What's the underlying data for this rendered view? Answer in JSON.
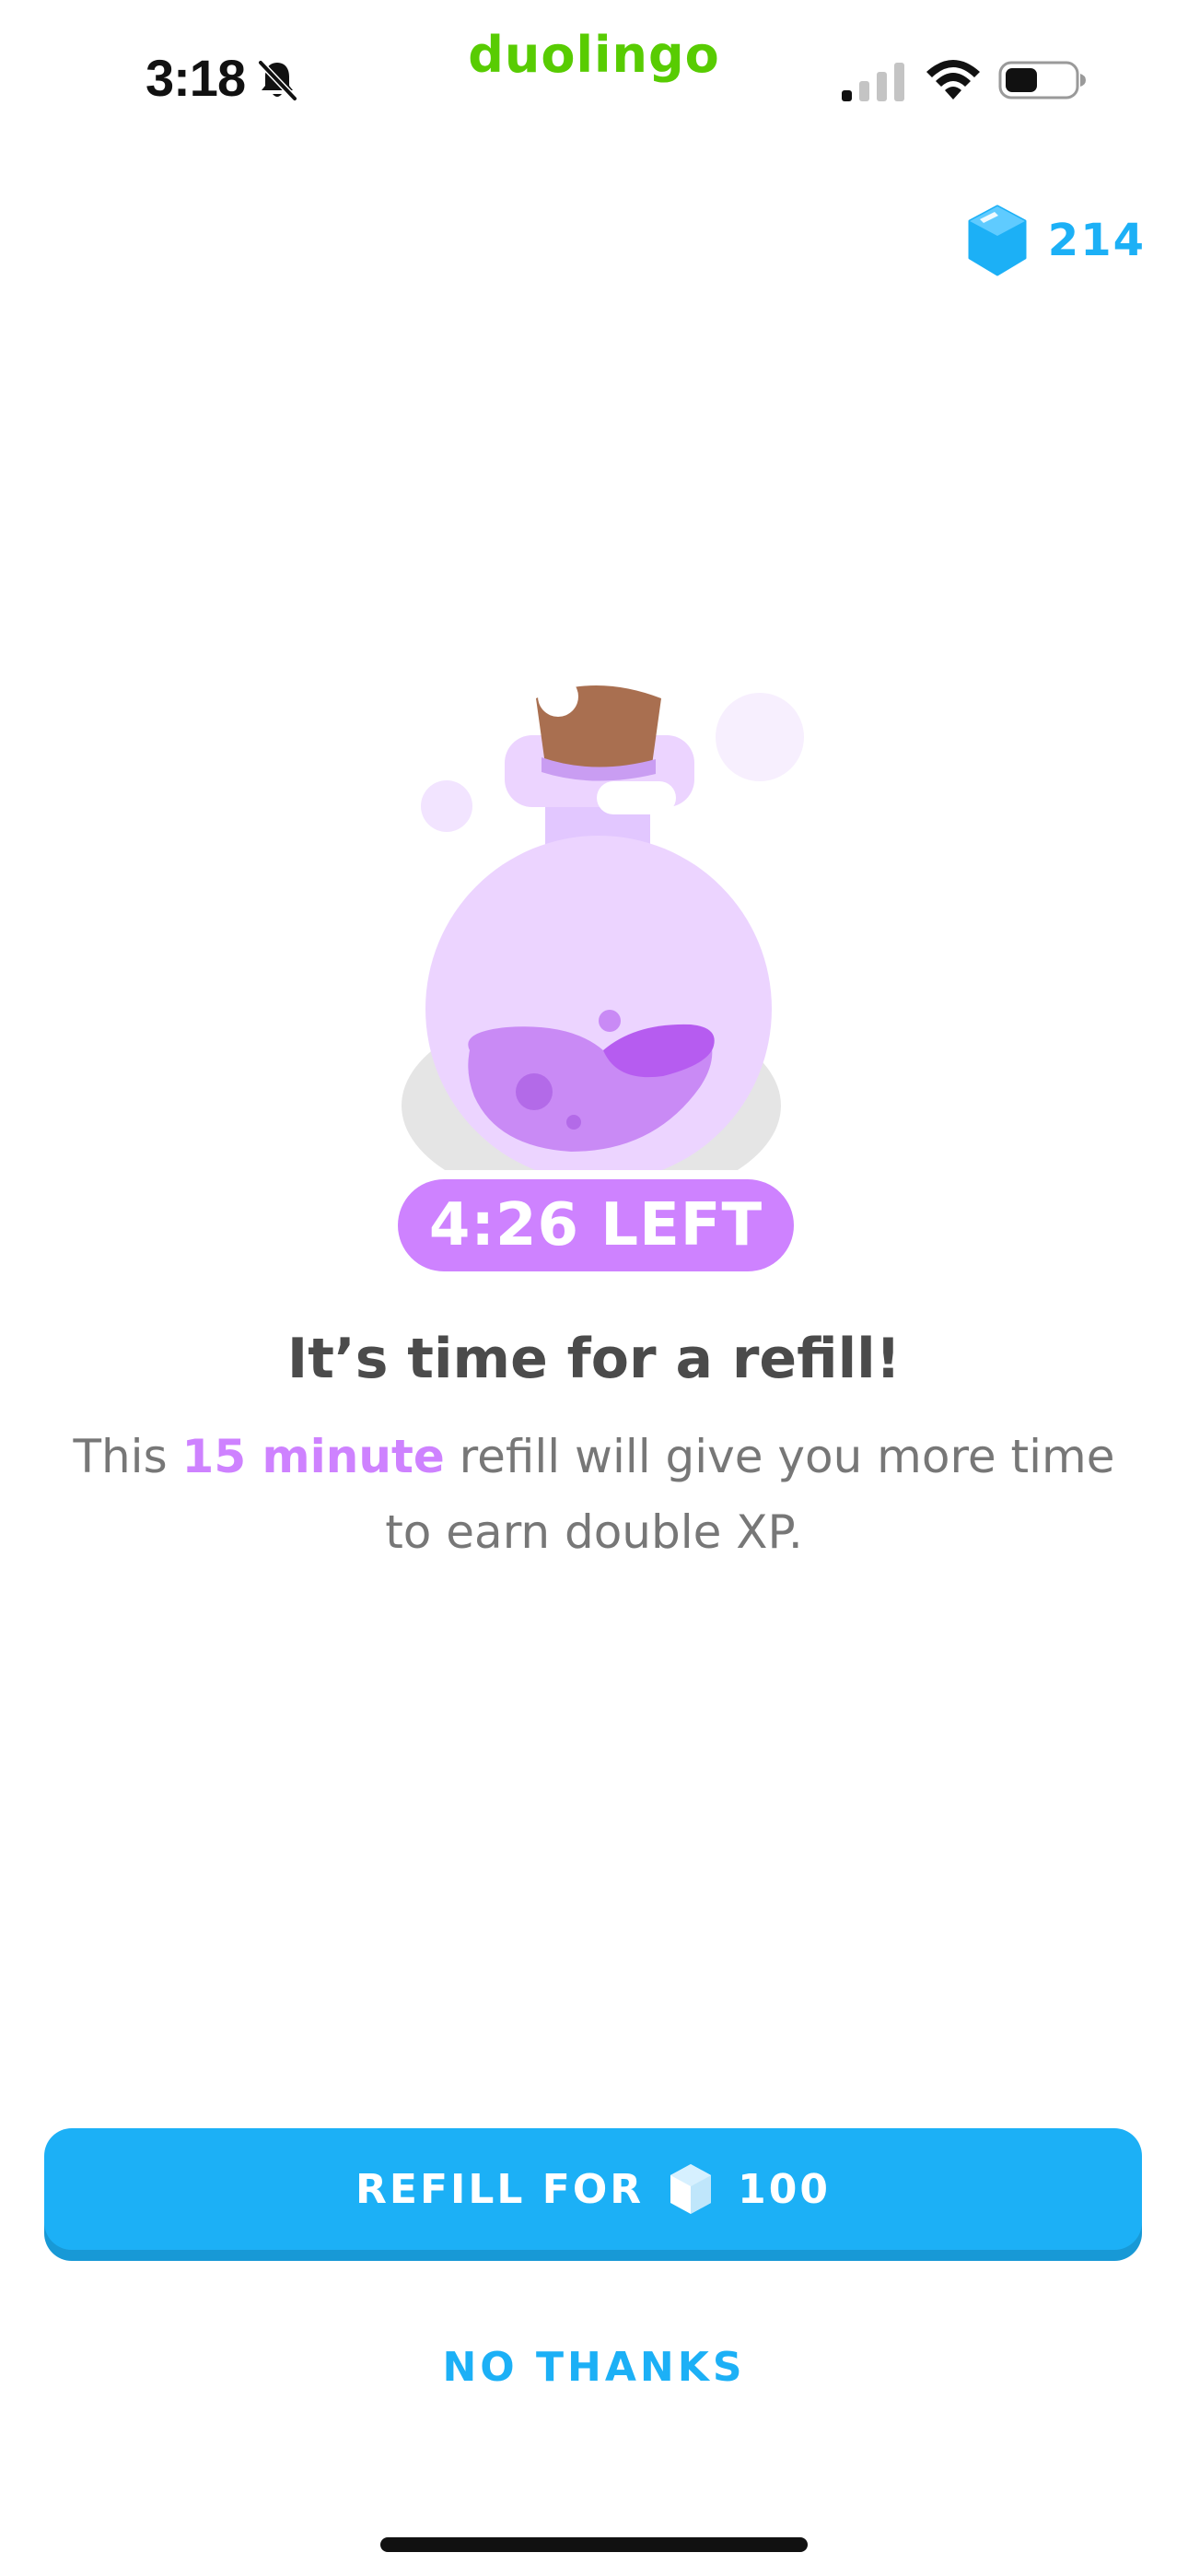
{
  "status_bar": {
    "time": "3:18",
    "app_name": "duolingo",
    "icons": [
      "bell-muted-icon",
      "signal-icon",
      "wifi-icon",
      "battery-icon"
    ]
  },
  "gems": {
    "count": "214",
    "icon": "gem-icon"
  },
  "potion": {
    "icon": "potion-bottle-icon",
    "time_left": "4:26 LEFT"
  },
  "content": {
    "headline": "It’s time for a refill!",
    "subtext_before": "This ",
    "subtext_highlight": "15 minute",
    "subtext_after": " refill will give you more time to earn double XP."
  },
  "actions": {
    "refill_label": "REFILL FOR",
    "refill_cost": "100",
    "no_thanks_label": "NO THANKS"
  },
  "colors": {
    "brand_green": "#58cc02",
    "gem_blue": "#1cb0f6",
    "button_shadow_blue": "#1899d6",
    "potion_purple": "#ce82ff",
    "headline_gray": "#4b4b4b",
    "body_gray": "#777777"
  }
}
